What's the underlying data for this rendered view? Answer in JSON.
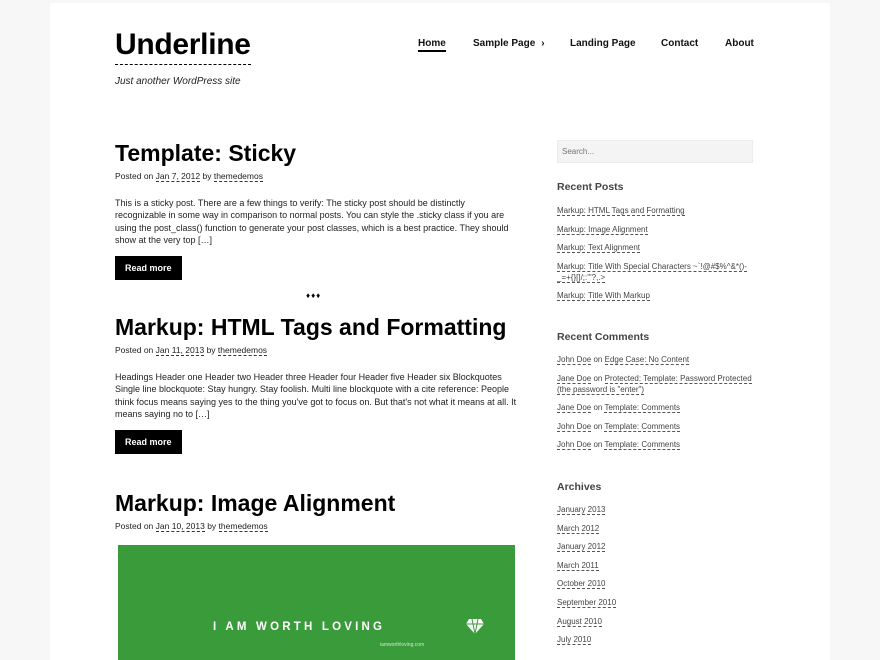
{
  "site": {
    "title": "Underline",
    "tagline": "Just another WordPress site"
  },
  "nav": [
    {
      "label": "Home",
      "current": true
    },
    {
      "label": "Sample Page",
      "has_children": true
    },
    {
      "label": "Landing Page"
    },
    {
      "label": "Contact"
    },
    {
      "label": "About"
    }
  ],
  "posts": [
    {
      "title": "Template: Sticky",
      "meta": {
        "prefix": "Posted on",
        "date": "Jan 7, 2012",
        "by": "by",
        "author": "themedemos"
      },
      "excerpt": "This is a sticky post. There are a few things to verify: The sticky post should be distinctly recognizable in some way in comparison to normal posts. You can style the .sticky class if you are using the post_class() function to generate your post classes, which is a best practice. They should show at the very top […]",
      "read_more": "Read more"
    },
    {
      "title": "Markup: HTML Tags and Formatting",
      "meta": {
        "prefix": "Posted on",
        "date": "Jan 11, 2013",
        "by": "by",
        "author": "themedemos"
      },
      "excerpt": "Headings Header one Header two Header three Header four Header five Header six Blockquotes Single line blockquote: Stay hungry. Stay foolish. Multi line blockquote with a cite reference: People think focus means saying yes to the thing you've got to focus on. But that's not what it means at all. It means saying no to […]",
      "read_more": "Read more"
    },
    {
      "title": "Markup: Image Alignment",
      "meta": {
        "prefix": "Posted on",
        "date": "Jan 10, 2013",
        "by": "by",
        "author": "themedemos"
      },
      "image_text": "I AM WORTH LOVING",
      "image_subtext": "iamworthloving.com"
    }
  ],
  "separator": "♦♦♦",
  "sidebar": {
    "search_placeholder": "Search...",
    "recent_posts": {
      "title": "Recent Posts",
      "items": [
        "Markup: HTML Tags and Formatting",
        "Markup: Image Alignment",
        "Markup: Text Alignment",
        "Markup: Title With Special Characters ~`!@#$%^&*()-_=+{}[]/;:'\"?,.>",
        "Markup: Title With Markup"
      ]
    },
    "recent_comments": {
      "title": "Recent Comments",
      "items": [
        {
          "author": "John Doe",
          "on": "on",
          "post": "Edge Case: No Content"
        },
        {
          "author": "Jane Doe",
          "on": "on",
          "post": "Protected: Template: Password Protected (the password is \"enter\")"
        },
        {
          "author": "Jane Doe",
          "on": "on",
          "post": "Template: Comments"
        },
        {
          "author": "John Doe",
          "on": "on",
          "post": "Template: Comments"
        },
        {
          "author": "John Doe",
          "on": "on",
          "post": "Template: Comments"
        }
      ]
    },
    "archives": {
      "title": "Archives",
      "items": [
        "January 2013",
        "March 2012",
        "January 2012",
        "March 2011",
        "October 2010",
        "September 2010",
        "August 2010",
        "July 2010"
      ]
    }
  },
  "colors": {
    "accent": "#000000",
    "featured_bg": "#3a9b3a"
  }
}
